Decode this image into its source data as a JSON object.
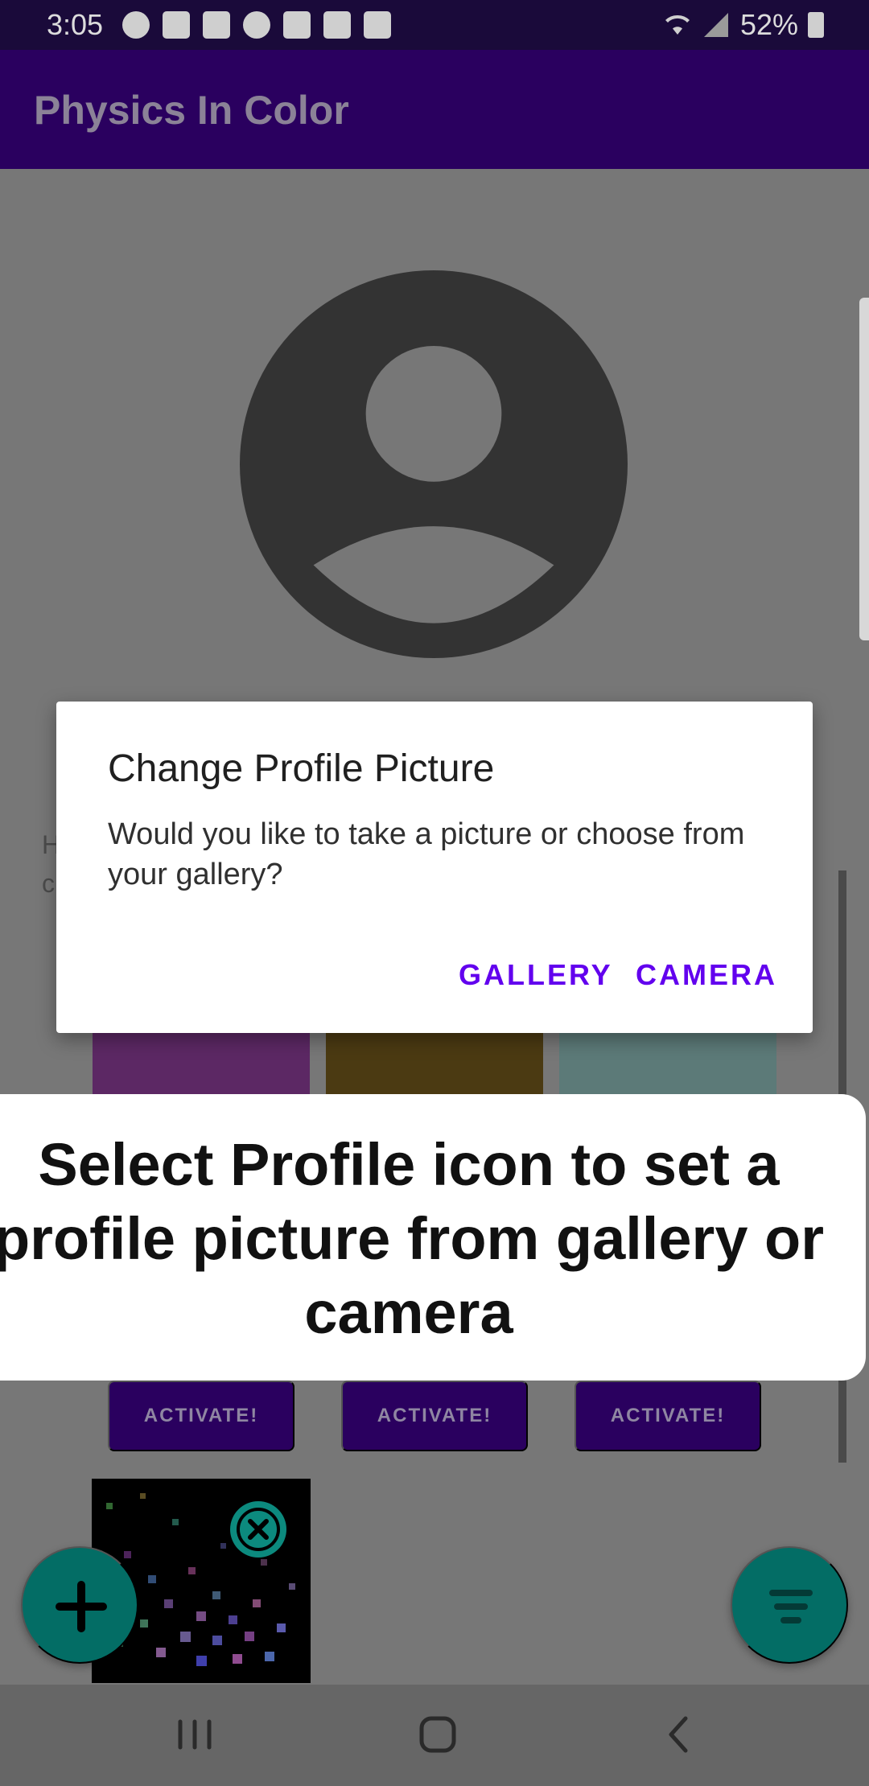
{
  "status_bar": {
    "time": "3:05",
    "battery": "52%",
    "icons": [
      "check-circle-icon",
      "news-icon",
      "news-icon",
      "android-icon",
      "news-icon",
      "image-icon",
      "close-box-icon"
    ]
  },
  "app_bar": {
    "title": "Physics In Color"
  },
  "background": {
    "partial_text": "H\nc"
  },
  "cards": {
    "activate_label": "ACTIVATE!"
  },
  "dialog": {
    "title": "Change Profile Picture",
    "message": "Would you like to take a picture or choose from your gallery?",
    "gallery_button": "GALLERY",
    "camera_button": "CAMERA"
  },
  "tutorial": {
    "text": "Select Profile icon to set a profile picture from gallery or camera"
  },
  "colors": {
    "primary": "#2a005f",
    "accent": "#6200ee",
    "fab": "#036d65"
  }
}
